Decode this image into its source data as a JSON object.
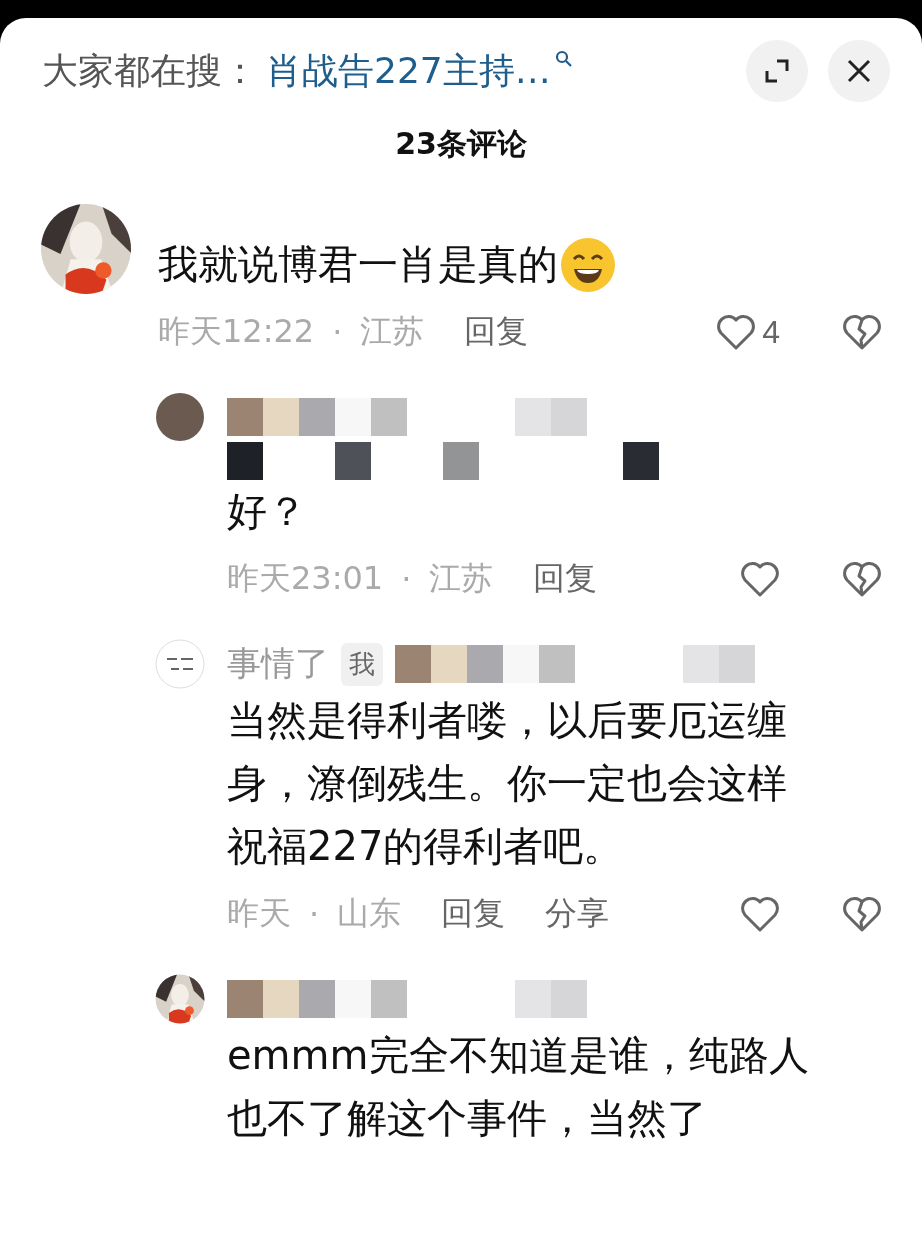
{
  "search_bar": {
    "label": "大家都在搜：",
    "query": "肖战告227主持…"
  },
  "comment_count": "23条评论",
  "comments": [
    {
      "kind": "top",
      "lines": [
        {
          "kind": "text_emoji",
          "text": "我就说博君一肖是真的"
        }
      ],
      "meta": {
        "time": "昨天12:22",
        "separator": "·",
        "location": "江苏",
        "reply": "回复",
        "likes": "4"
      }
    },
    {
      "kind": "reply",
      "name": [
        {
          "kind": "masked"
        }
      ],
      "lines": [
        {
          "kind": "masked"
        },
        {
          "kind": "text",
          "text": "好？"
        }
      ],
      "meta": {
        "time": "昨天23:01",
        "separator": "·",
        "location": "江苏",
        "reply": "回复"
      }
    },
    {
      "kind": "reply",
      "name": [
        {
          "kind": "text",
          "text": "事情了"
        },
        {
          "kind": "badge",
          "text": "我"
        },
        {
          "kind": "masked"
        }
      ],
      "lines": [
        {
          "kind": "text",
          "text": "当然是得利者喽，以后要厄运缠"
        },
        {
          "kind": "text",
          "text": "身，潦倒残生。你一定也会这样"
        },
        {
          "kind": "text",
          "text": "祝福227的得利者吧。"
        }
      ],
      "meta": {
        "time": "昨天",
        "separator": "·",
        "location": "山东",
        "reply": "回复",
        "share": "分享"
      }
    },
    {
      "kind": "reply",
      "name": [
        {
          "kind": "masked"
        }
      ],
      "lines": [
        {
          "kind": "text",
          "text": "emmm完全不知道是谁，纯路人"
        },
        {
          "kind": "text",
          "text": "也不了解这个事件，当然了"
        }
      ]
    }
  ]
}
